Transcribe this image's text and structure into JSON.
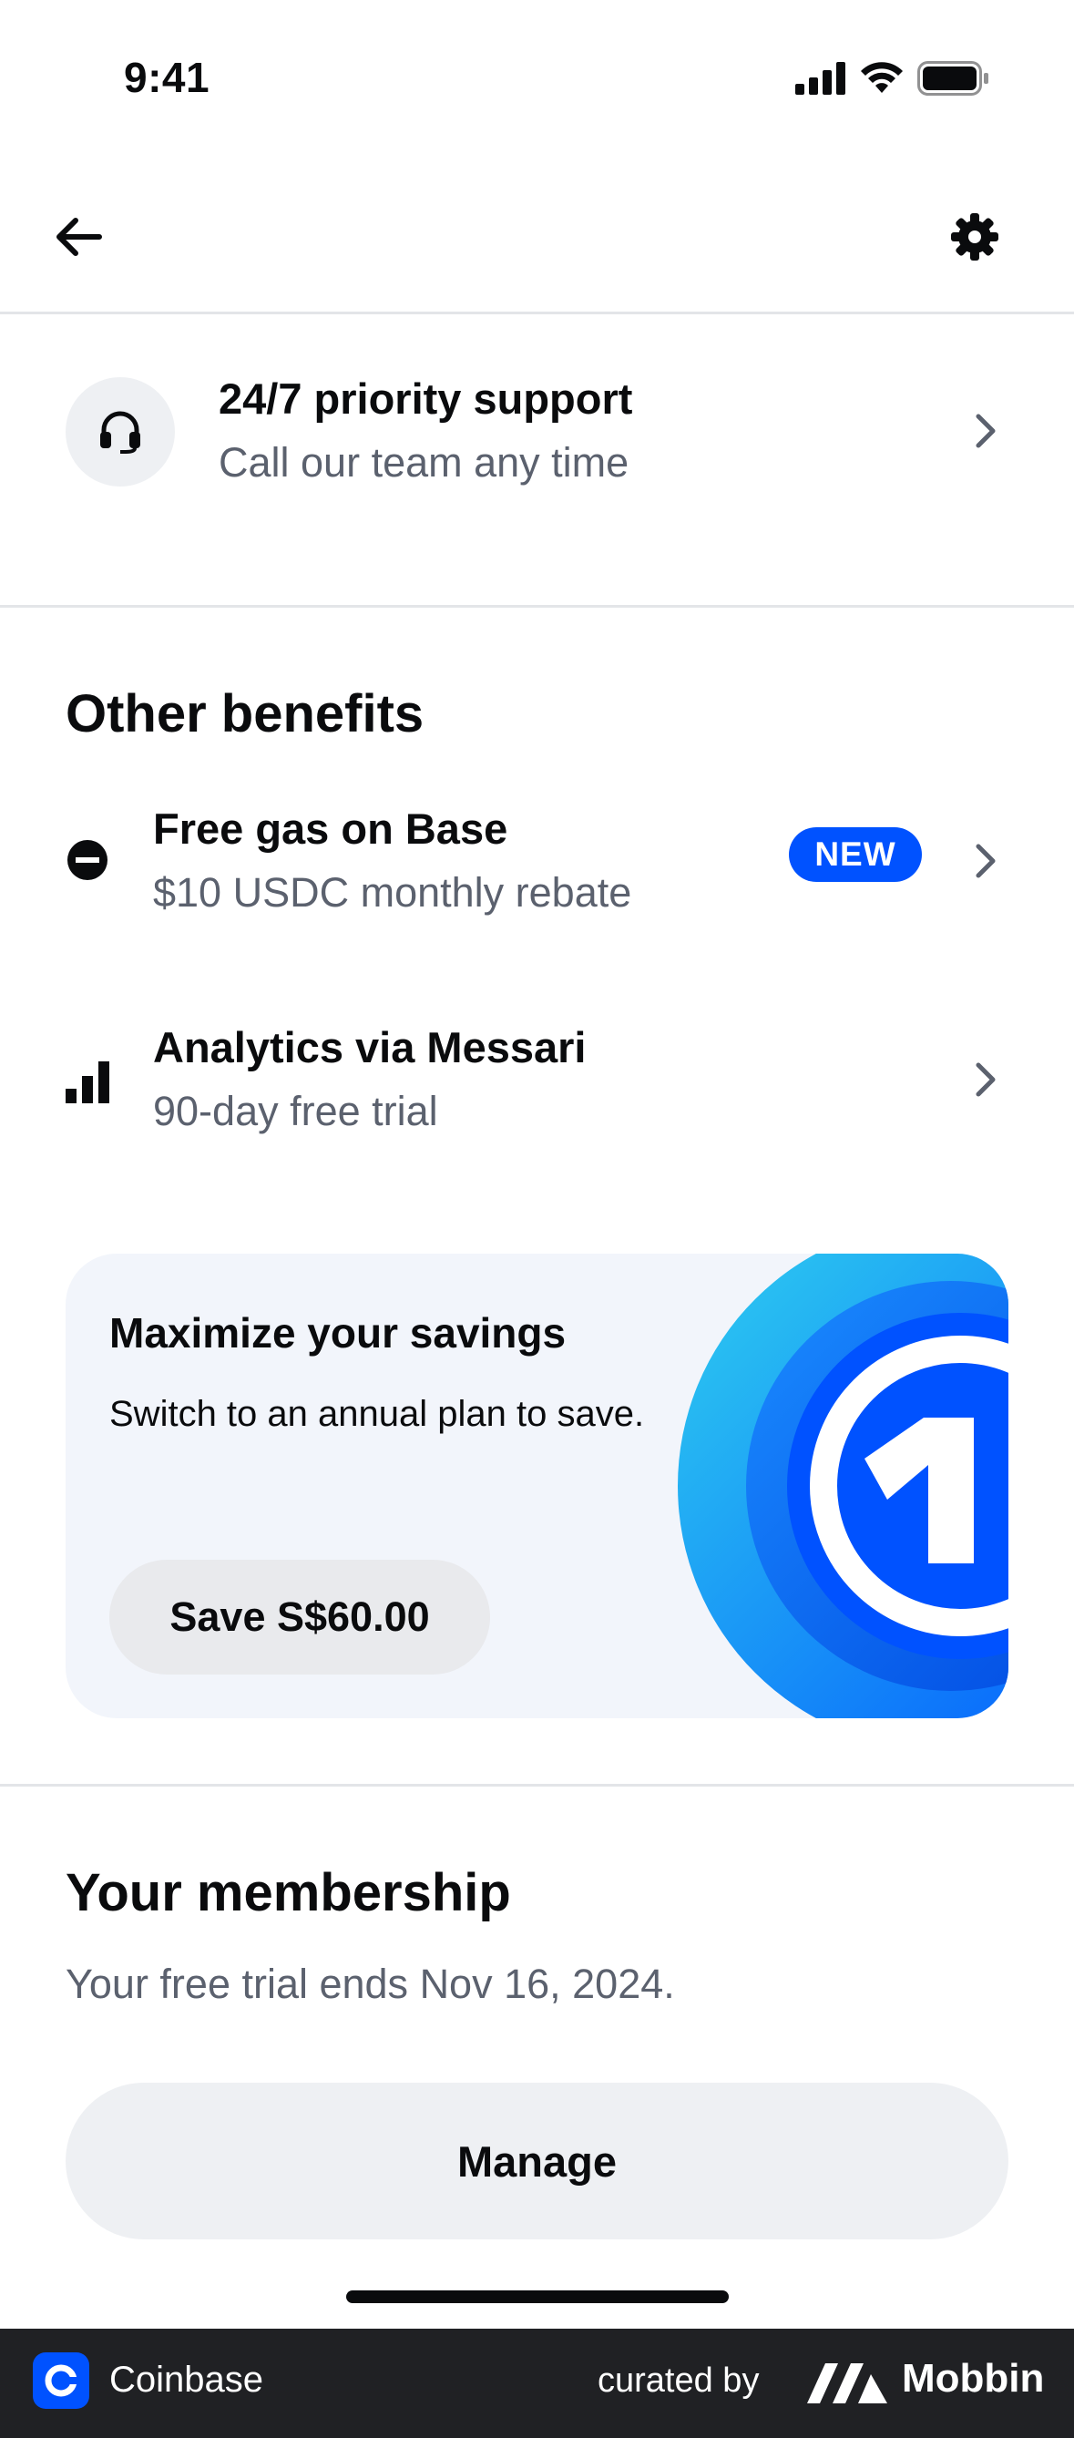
{
  "status_bar": {
    "time": "9:41"
  },
  "nav": {
    "back_icon": "arrow-left-icon",
    "settings_icon": "gear-icon"
  },
  "support": {
    "icon": "headset-icon",
    "title": "24/7 priority support",
    "subtitle": "Call our team any time"
  },
  "other_benefits": {
    "heading": "Other benefits",
    "items": [
      {
        "icon": "base-icon",
        "title": "Free gas on Base",
        "subtitle": "$10 USDC monthly rebate",
        "badge": "NEW"
      },
      {
        "icon": "bar-chart-icon",
        "title": "Analytics via Messari",
        "subtitle": "90-day free trial"
      }
    ]
  },
  "promo": {
    "title": "Maximize your savings",
    "body": "Switch to an annual plan to save.",
    "button_label": "Save S$60.00",
    "colors": {
      "card_bg": "#f2f5fb",
      "art_blue": "#0052ff",
      "art_cyan": "#2fd0ef"
    }
  },
  "membership": {
    "heading": "Your membership",
    "text": "Your free trial ends Nov 16, 2024.",
    "button_label": "Manage"
  },
  "footer": {
    "app_name": "Coinbase",
    "curated_by": "curated by",
    "brand": "Mobbin"
  },
  "colors": {
    "accent": "#0052ff",
    "text_primary": "#0a0b0d",
    "text_secondary": "#5b616e",
    "divider": "#e3e5e8"
  }
}
